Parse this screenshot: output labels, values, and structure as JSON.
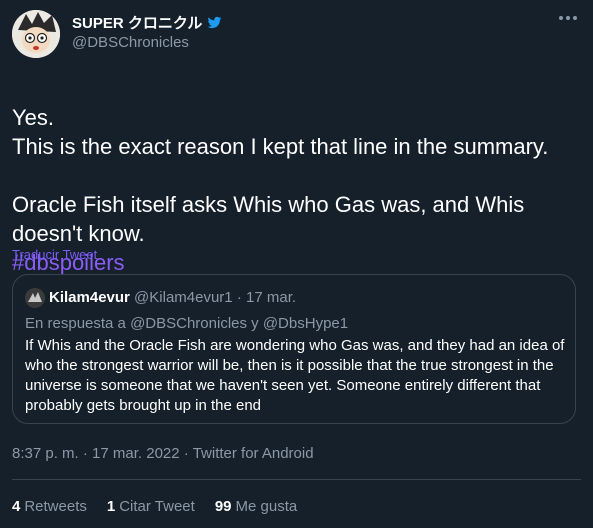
{
  "author": {
    "name": "SUPER クロニクル",
    "handle": "@DBSChronicles"
  },
  "tweet": {
    "text": "Yes.\nThis is the exact reason I kept that line in the summary.\n\nOracle Fish itself asks Whis who Gas was, and Whis doesn't know.",
    "hashtag": "#dbspoilers",
    "translate_label": "Traducir Tweet"
  },
  "quote": {
    "name": "Kilam4evur",
    "handle": "@Kilam4evur1",
    "separator": "·",
    "date": "17 mar.",
    "reply_to": "En respuesta a @DBSChronicles y @DbsHype1",
    "text": "If Whis and the Oracle Fish are wondering who Gas was, and they had an idea of who the strongest warrior will be, then is it possible that the true strongest in the universe is someone that we haven't seen yet. Someone entirely different that probably gets brought up in the end"
  },
  "meta": {
    "time": "8:37 p. m.",
    "sep": "·",
    "date": "17 mar. 2022",
    "source": "Twitter for Android"
  },
  "stats": {
    "retweets_count": "4",
    "retweets_label": "Retweets",
    "quotes_count": "1",
    "quotes_label": "Citar Tweet",
    "likes_count": "99",
    "likes_label": "Me gusta"
  },
  "colors": {
    "background": "#15202b",
    "accent": "#8b5cf6",
    "muted": "#8b98a5",
    "border": "#38444d"
  }
}
